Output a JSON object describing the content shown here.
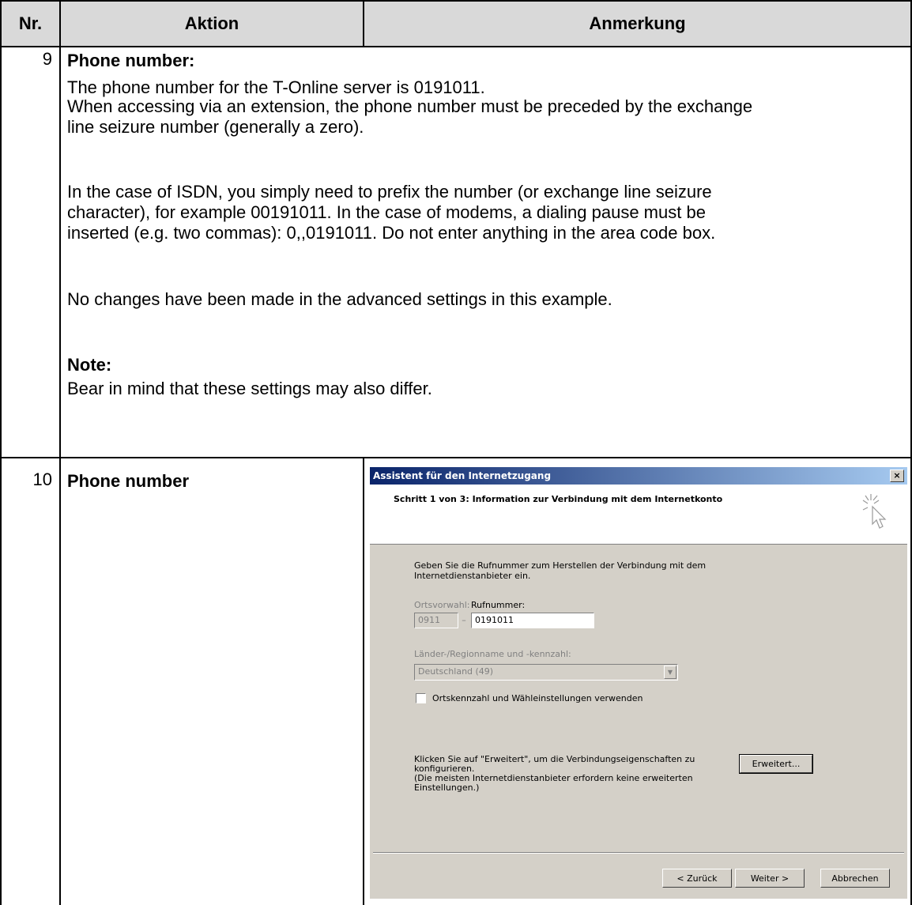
{
  "table": {
    "headers": {
      "nr": "Nr.",
      "aktion": "Aktion",
      "anmerkung": "Anmerkung"
    },
    "row9": {
      "number": "9",
      "heading": "Phone number:",
      "p1": "The phone number for the T-Online server is 0191011.",
      "p2a": "When accessing via an extension, the phone number must be preceded by the exchange",
      "p2b": "line seizure number (generally a zero).",
      "p3a": "In the case of ISDN, you simply need to prefix the number (or exchange line seizure",
      "p3b": "character), for example 00191011. In the case of modems, a dialing pause must be",
      "p3c": "inserted (e.g. two commas): 0,,0191011. Do not enter anything in the area code box.",
      "p4": "No changes have been made in the advanced settings in this example.",
      "note_heading": "Note:",
      "note_text": "Bear in mind that these settings may also differ."
    },
    "row10": {
      "number": "10",
      "heading": "Phone number"
    }
  },
  "dialog": {
    "title": "Assistent für den Internetzugang",
    "close": "×",
    "step": "Schritt 1 von 3: Information zur Verbindung mit dem Internetkonto",
    "intro_line1": "Geben Sie die Rufnummer zum Herstellen der Verbindung mit dem",
    "intro_line2": "Internetdienstanbieter ein.",
    "area_code_label": "Ortsvorwahl:",
    "area_code_value": "0911",
    "dash": "–",
    "phone_label": "Rufnummer:",
    "phone_value": "0191011",
    "country_label": "Länder-/Regionname und -kennzahl:",
    "country_value": "Deutschland (49)",
    "checkbox_label": "Ortskennzahl und Wähleinstellungen verwenden",
    "advanced_line1": "Klicken Sie auf \"Erweitert\", um die Verbindungseigenschaften zu",
    "advanced_line2": "konfigurieren.",
    "advanced_line3": "(Die meisten Internetdienstanbieter erfordern keine erweiterten",
    "advanced_line4": "Einstellungen.)",
    "advanced_button": "Erweitert...",
    "back_button": "< Zurück",
    "next_button": "Weiter >",
    "cancel_button": "Abbrechen"
  }
}
